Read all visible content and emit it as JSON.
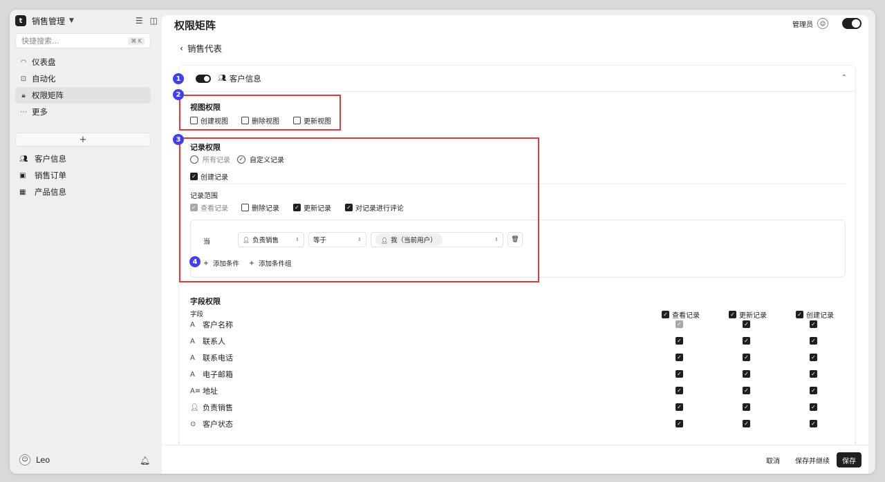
{
  "sidebar": {
    "app_name": "销售管理",
    "search_placeholder": "快捷搜索...",
    "search_shortcut": "⌘ K",
    "nav": [
      {
        "label": "仪表盘"
      },
      {
        "label": "自动化"
      },
      {
        "label": "权限矩阵"
      },
      {
        "label": "更多"
      }
    ],
    "tables": [
      {
        "label": "客户信息"
      },
      {
        "label": "销售订单"
      },
      {
        "label": "产品信息"
      }
    ],
    "user_name": "Leo"
  },
  "header": {
    "title": "权限矩阵",
    "role": "管理员",
    "back_label": "销售代表"
  },
  "card": {
    "title": "客户信息",
    "badges": [
      "1",
      "2",
      "3",
      "4"
    ],
    "view_perm": {
      "title": "视图权限",
      "options": [
        {
          "label": "创建视图",
          "checked": false
        },
        {
          "label": "删除视图",
          "checked": false
        },
        {
          "label": "更新视图",
          "checked": false
        }
      ]
    },
    "record_perm": {
      "title": "记录权限",
      "radio_all": "所有记录",
      "radio_custom": "自定义记录",
      "create_record": "创建记录",
      "scope_title": "记录范围",
      "scope_options": [
        {
          "label": "查看记录",
          "state": "disabled"
        },
        {
          "label": "删除记录",
          "state": "off"
        },
        {
          "label": "更新记录",
          "state": "on"
        },
        {
          "label": "对记录进行评论",
          "state": "on"
        }
      ],
      "condition": {
        "when": "当",
        "field": "负责销售",
        "operator": "等于",
        "value": "我（当前用户）"
      },
      "add_condition": "添加条件",
      "add_group": "添加条件组"
    },
    "field_perm": {
      "title": "字段权限",
      "col_field": "字段",
      "cols": [
        "查看记录",
        "更新记录",
        "创建记录"
      ],
      "rows": [
        {
          "name": "客户名称",
          "icon": "text-icon",
          "view": "disabled",
          "update": "on",
          "create": "on"
        },
        {
          "name": "联系人",
          "icon": "text-icon",
          "view": "on",
          "update": "on",
          "create": "on"
        },
        {
          "name": "联系电话",
          "icon": "text-icon",
          "view": "on",
          "update": "on",
          "create": "on"
        },
        {
          "name": "电子邮箱",
          "icon": "text-icon",
          "view": "on",
          "update": "on",
          "create": "on"
        },
        {
          "name": "地址",
          "icon": "long-text-icon",
          "view": "on",
          "update": "on",
          "create": "on"
        },
        {
          "name": "负责销售",
          "icon": "user-icon",
          "view": "on",
          "update": "on",
          "create": "on"
        },
        {
          "name": "客户状态",
          "icon": "status-icon",
          "view": "on",
          "update": "on",
          "create": "on"
        }
      ]
    }
  },
  "footer": {
    "cancel": "取消",
    "save_continue": "保存并继续",
    "save": "保存"
  },
  "colors": {
    "accent": "#1f1f1f",
    "badge": "#4040f0",
    "highlight": "#e23a3a"
  }
}
